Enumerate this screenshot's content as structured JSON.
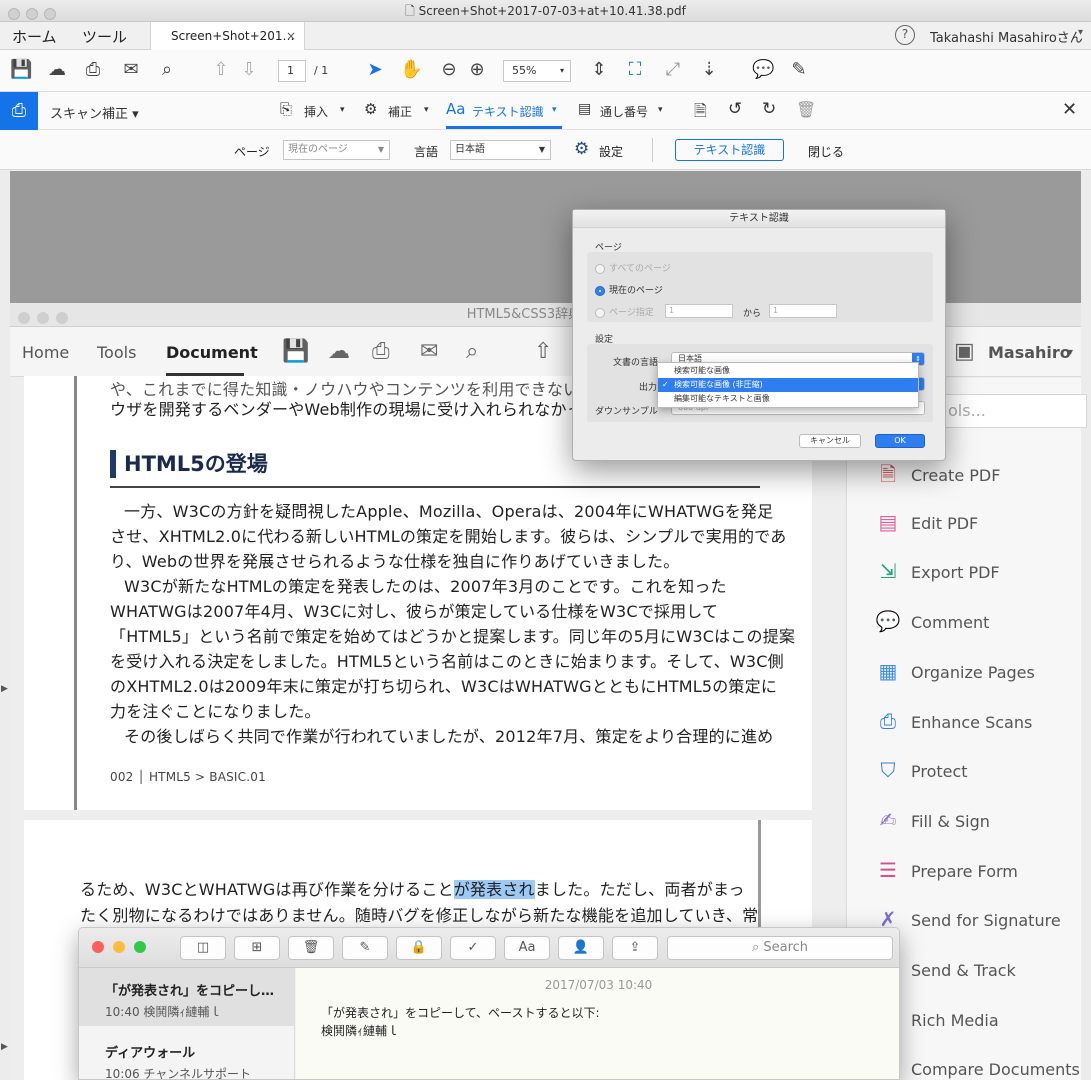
{
  "window": {
    "title": "Screen+Shot+2017-07-03+at+10.41.38.pdf"
  },
  "tabs": {
    "home": "ホーム",
    "tools": "ツール",
    "doc_tab": "Screen+Shot+201…",
    "close": "×"
  },
  "user": {
    "name": "Takahashi Masahiroさん",
    "help": "?"
  },
  "toolbar": {
    "page_current": "1",
    "page_total": "/ 1",
    "zoom": "55%"
  },
  "scanbar": {
    "title": "スキャン補正 ▾",
    "insert": "挿入",
    "enhance": "補正",
    "ocr": "テキスト認識",
    "bates": "通し番号",
    "close": "✕"
  },
  "ocrbar": {
    "page_label": "ページ",
    "page_value": "現在のページ",
    "lang_label": "言語",
    "lang_value": "日本語",
    "settings": "設定",
    "ocr_button": "テキスト認識",
    "close": "閉じる"
  },
  "dialog": {
    "title": "テキスト認識",
    "page_group": "ページ",
    "all_pages": "すべてのページ",
    "current_page": "現在のページ",
    "page_range": "ページ指定",
    "from": "から",
    "from_value": "1",
    "to_value": "1",
    "settings_group": "設定",
    "doc_lang_label": "文書の言語",
    "doc_lang_value": "日本語",
    "output_label": "出力",
    "downsample_label": "ダウンサンプル",
    "downsample_value": "600 dpi",
    "menu": [
      "検索可能な画像",
      "検索可能な画像 (非圧縮)",
      "編集可能なテキストと画像"
    ],
    "cancel": "キャンセル",
    "ok": "OK"
  },
  "inner": {
    "title": "HTML5&CSS3辞典_JPtest",
    "nav": [
      "Home",
      "Tools",
      "Document"
    ],
    "user": "Masahiro",
    "search_placeholder": "ols..."
  },
  "page1": {
    "top1": "や、これまでに得た知識・ノウハウやコンテンツを利用できない実用性",
    "top2": "ウザを開発するベンダーやWeb制作の現場に受け入れられなかった",
    "heading": "HTML5の登場",
    "lines": [
      "一方、W3Cの方針を疑問視したApple、Mozilla、Operaは、2004年にWHATWGを発足",
      "させ、XHTML2.0に代わる新しいHTMLの策定を開始します。彼らは、シンプルで実用的であ",
      "り、Webの世界を発展させられるような仕様を独自に作りあげていきました。",
      "W3Cが新たなHTMLの策定を発表したのは、2007年3月のことです。これを知った",
      "WHATWGは2007年4月、W3Cに対し、彼らが策定している仕様をW3Cで採用して",
      "「HTML5」という名前で策定を始めてはどうかと提案します。同じ年の5月にW3Cはこの提案",
      "を受け入れる決定をしました。HTML5という名前はこのときに始まります。そして、W3C側",
      "のXHTML2.0は2009年末に策定が打ち切られ、W3CはWHATWGとともにHTML5の策定に",
      "力を注ぐことになりました。",
      "その後しばらく共同で作業が行われていましたが、2012年7月、策定をより合理的に進め"
    ],
    "footer": "002 │ HTML5 > BASIC.01"
  },
  "page2": {
    "line1_a": "るため、W3CとWHATWGは再び作業を分けること",
    "line1_hl": "が発表され",
    "line1_b": "ました。ただし、両者がまっ",
    "line2": "たく別物になるわけではありません。随時バグを修正しながら新たな機能を追加していき、常"
  },
  "rpanel": [
    {
      "label": "Create PDF",
      "icon": "create-pdf-icon",
      "color": "#d9534f"
    },
    {
      "label": "Edit PDF",
      "icon": "edit-pdf-icon",
      "color": "#e0609a"
    },
    {
      "label": "Export PDF",
      "icon": "export-pdf-icon",
      "color": "#21a67a"
    },
    {
      "label": "Comment",
      "icon": "comment-icon",
      "color": "#f0b400"
    },
    {
      "label": "Organize Pages",
      "icon": "organize-pages-icon",
      "color": "#3f8fe8"
    },
    {
      "label": "Enhance Scans",
      "icon": "enhance-scans-icon",
      "color": "#2f80d8"
    },
    {
      "label": "Protect",
      "icon": "protect-icon",
      "color": "#3a7fd0"
    },
    {
      "label": "Fill & Sign",
      "icon": "fill-sign-icon",
      "color": "#8a6fd8"
    },
    {
      "label": "Prepare Form",
      "icon": "prepare-form-icon",
      "color": "#d8508a"
    },
    {
      "label": "Send for Signature",
      "icon": "send-signature-icon",
      "color": "#7a6ad8"
    },
    {
      "label": "Send & Track",
      "icon": "send-track-icon",
      "color": "#3a7fd0"
    },
    {
      "label": "Rich Media",
      "icon": "rich-media-icon",
      "color": "#3a7fd0"
    },
    {
      "label": "Compare Documents",
      "icon": "compare-icon",
      "color": "#d85050"
    }
  ],
  "notes": {
    "search": "Search",
    "items": [
      {
        "title": "「が発表され」をコピーし…",
        "sub": "10:40 検鬨隣ｨ縺輔ｌ"
      },
      {
        "title": "ディアウォール",
        "sub": "10:06 チャンネルサポート"
      }
    ],
    "date": "2017/07/03 10:40",
    "body1": "「が発表され」をコピーして、ペーストすると以下:",
    "body2": "検鬨隣ｨ縺輔ｌ"
  },
  "colors": {
    "accent": "#1473e6",
    "selection": "#2e7ef0"
  }
}
